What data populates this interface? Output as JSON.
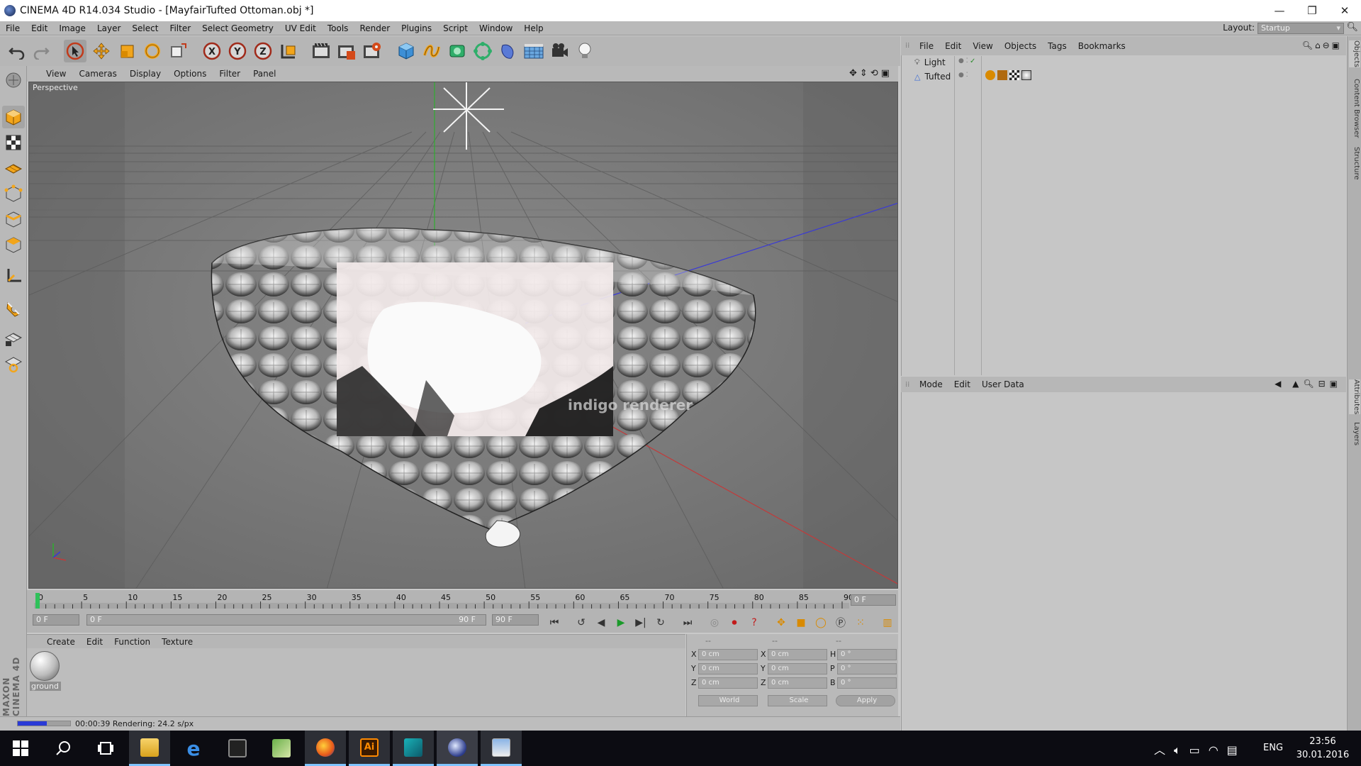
{
  "window": {
    "title": "CINEMA 4D R14.034 Studio - [MayfairTufted Ottoman.obj *]",
    "controls": {
      "minimize": "—",
      "maximize": "❐",
      "close": "✕"
    }
  },
  "menubar": {
    "items": [
      "File",
      "Edit",
      "Image",
      "Layer",
      "Select",
      "Filter",
      "Select Geometry",
      "UV Edit",
      "Tools",
      "Render",
      "Plugins",
      "Script",
      "Window",
      "Help"
    ],
    "layout_label": "Layout:",
    "layout_value": "Startup"
  },
  "toolbar": {
    "icons": [
      "undo-icon",
      "redo-icon",
      "select-arrow-icon",
      "move-icon",
      "scale-icon",
      "rotate-icon",
      "render-region-icon",
      "x-axis-icon",
      "y-axis-icon",
      "z-axis-icon",
      "coordinate-system-icon",
      "render-view-icon",
      "render-picture-viewer-icon",
      "edit-render-settings-icon",
      "cube-primitive-icon",
      "spline-icon",
      "nurbs-icon",
      "array-icon",
      "deformer-icon",
      "scene-floor-icon",
      "camera-icon",
      "light-icon"
    ],
    "axis_labels": [
      "X",
      "Y",
      "Z"
    ]
  },
  "viewport": {
    "menu": [
      "View",
      "Cameras",
      "Display",
      "Options",
      "Filter",
      "Panel"
    ],
    "label": "Perspective",
    "watermark": "indigo renderer",
    "render_region_color": "#f3eaea"
  },
  "timeline": {
    "ticks": [
      "0",
      "5",
      "10",
      "15",
      "20",
      "25",
      "30",
      "35",
      "40",
      "45",
      "50",
      "55",
      "60",
      "65",
      "70",
      "75",
      "80",
      "85",
      "90"
    ],
    "current_frame": "0 F",
    "start_field": "0 F",
    "range_start": "0 F",
    "range_end": "90 F",
    "end_field": "90 F"
  },
  "material_manager": {
    "menu": [
      "Create",
      "Edit",
      "Function",
      "Texture"
    ],
    "materials": [
      {
        "name": "ground"
      }
    ]
  },
  "coordinates": {
    "headers": [
      "--",
      "--",
      "--"
    ],
    "rows": [
      {
        "pos_label": "X",
        "pos": "0 cm",
        "size_label": "X",
        "size": "0 cm",
        "rot_label": "H",
        "rot": "0 °"
      },
      {
        "pos_label": "Y",
        "pos": "0 cm",
        "size_label": "Y",
        "size": "0 cm",
        "rot_label": "P",
        "rot": "0 °"
      },
      {
        "pos_label": "Z",
        "pos": "0 cm",
        "size_label": "Z",
        "size": "0 cm",
        "rot_label": "B",
        "rot": "0 °"
      }
    ],
    "space": "World",
    "mode": "Scale",
    "apply_label": "Apply"
  },
  "statusbar": {
    "text": "00:00:39 Rendering: 24.2 s/px",
    "progress": 0.55
  },
  "object_manager": {
    "menu": [
      "File",
      "Edit",
      "View",
      "Objects",
      "Tags",
      "Bookmarks"
    ],
    "objects": [
      {
        "name": "Light"
      },
      {
        "name": "Tufted"
      }
    ]
  },
  "attribute_manager": {
    "menu": [
      "Mode",
      "Edit",
      "User Data"
    ]
  },
  "side_tabs": [
    "Objects",
    "Content Browser",
    "Structure",
    "Attributes",
    "Layers"
  ],
  "brand_vertical": "MAXON CINEMA 4D",
  "taskbar": {
    "apps": [
      "start-icon",
      "search-icon",
      "task-view-icon",
      "file-explorer-icon",
      "edge-icon",
      "terminal-icon",
      "photo-icon",
      "firefox-icon",
      "illustrator-icon",
      "maya-icon",
      "cinema4d-icon",
      "picture-viewer-icon"
    ],
    "tray": {
      "language": "ENG",
      "time": "23:56",
      "date": "30.01.2016"
    }
  }
}
